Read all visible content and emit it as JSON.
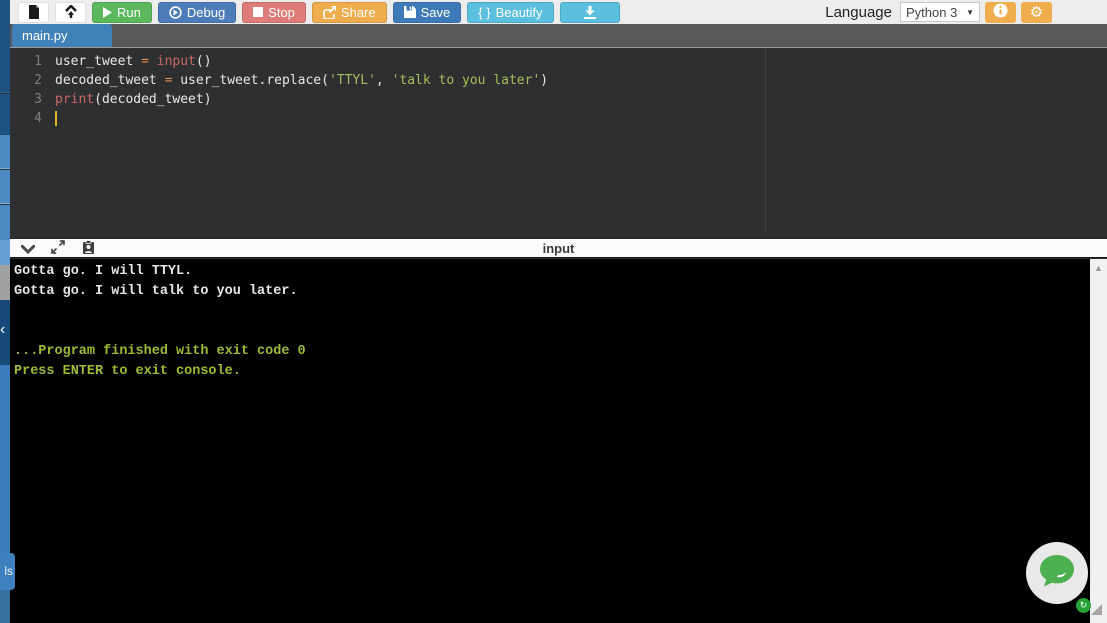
{
  "toolbar": {
    "run_label": "Run",
    "debug_label": "Debug",
    "stop_label": "Stop",
    "share_label": "Share",
    "save_label": "Save",
    "beautify_label": "Beautify",
    "beautify_icon_text": "{ }",
    "language_label": "Language",
    "language_value": "Python 3"
  },
  "tabs": {
    "active_label": "main.py"
  },
  "editor": {
    "lines": [
      {
        "number": "1",
        "tokens": [
          {
            "t": "user_tweet ",
            "c": "default"
          },
          {
            "t": "=",
            "c": "op"
          },
          {
            "t": " ",
            "c": "default"
          },
          {
            "t": "input",
            "c": "builtin"
          },
          {
            "t": "()",
            "c": "default"
          }
        ]
      },
      {
        "number": "2",
        "tokens": [
          {
            "t": "decoded_tweet ",
            "c": "default"
          },
          {
            "t": "=",
            "c": "op"
          },
          {
            "t": " user_tweet.replace(",
            "c": "default"
          },
          {
            "t": "'TTYL'",
            "c": "string"
          },
          {
            "t": ", ",
            "c": "default"
          },
          {
            "t": "'talk to you later'",
            "c": "string"
          },
          {
            "t": ")",
            "c": "default"
          }
        ]
      },
      {
        "number": "3",
        "tokens": [
          {
            "t": "print",
            "c": "builtin"
          },
          {
            "t": "(decoded_tweet)",
            "c": "default"
          }
        ]
      },
      {
        "number": "4",
        "tokens": [],
        "cursor": true
      }
    ]
  },
  "console_header": {
    "title": "input"
  },
  "console": {
    "lines": [
      {
        "text": "Gotta go. I will TTYL.",
        "kind": "out"
      },
      {
        "text": "Gotta go. I will talk to you later.",
        "kind": "out"
      },
      {
        "text": "",
        "kind": "out"
      },
      {
        "text": "",
        "kind": "out"
      },
      {
        "text": "...Program finished with exit code 0",
        "kind": "sys"
      },
      {
        "text": "Press ENTER to exit console.",
        "kind": "sys"
      }
    ]
  },
  "sidebar": {
    "collapse_arrow": "‹",
    "bottom_tab_label": "ls"
  },
  "scrollbar": {
    "up_arrow": "▲"
  },
  "colors": {
    "run": "#5cb85c",
    "debug": "#4d7db9",
    "stop": "#dd7c79",
    "share": "#f0ad4e",
    "save": "#3f7ab8",
    "beautify": "#5bc0de",
    "accent_tab": "#4181b9",
    "editor_bg": "#2d2f31",
    "string": "#a9bd58",
    "builtin": "#cc6666",
    "operator": "#e78c45",
    "console_sys": "#9cbb34",
    "chat_green": "#4caf50"
  }
}
